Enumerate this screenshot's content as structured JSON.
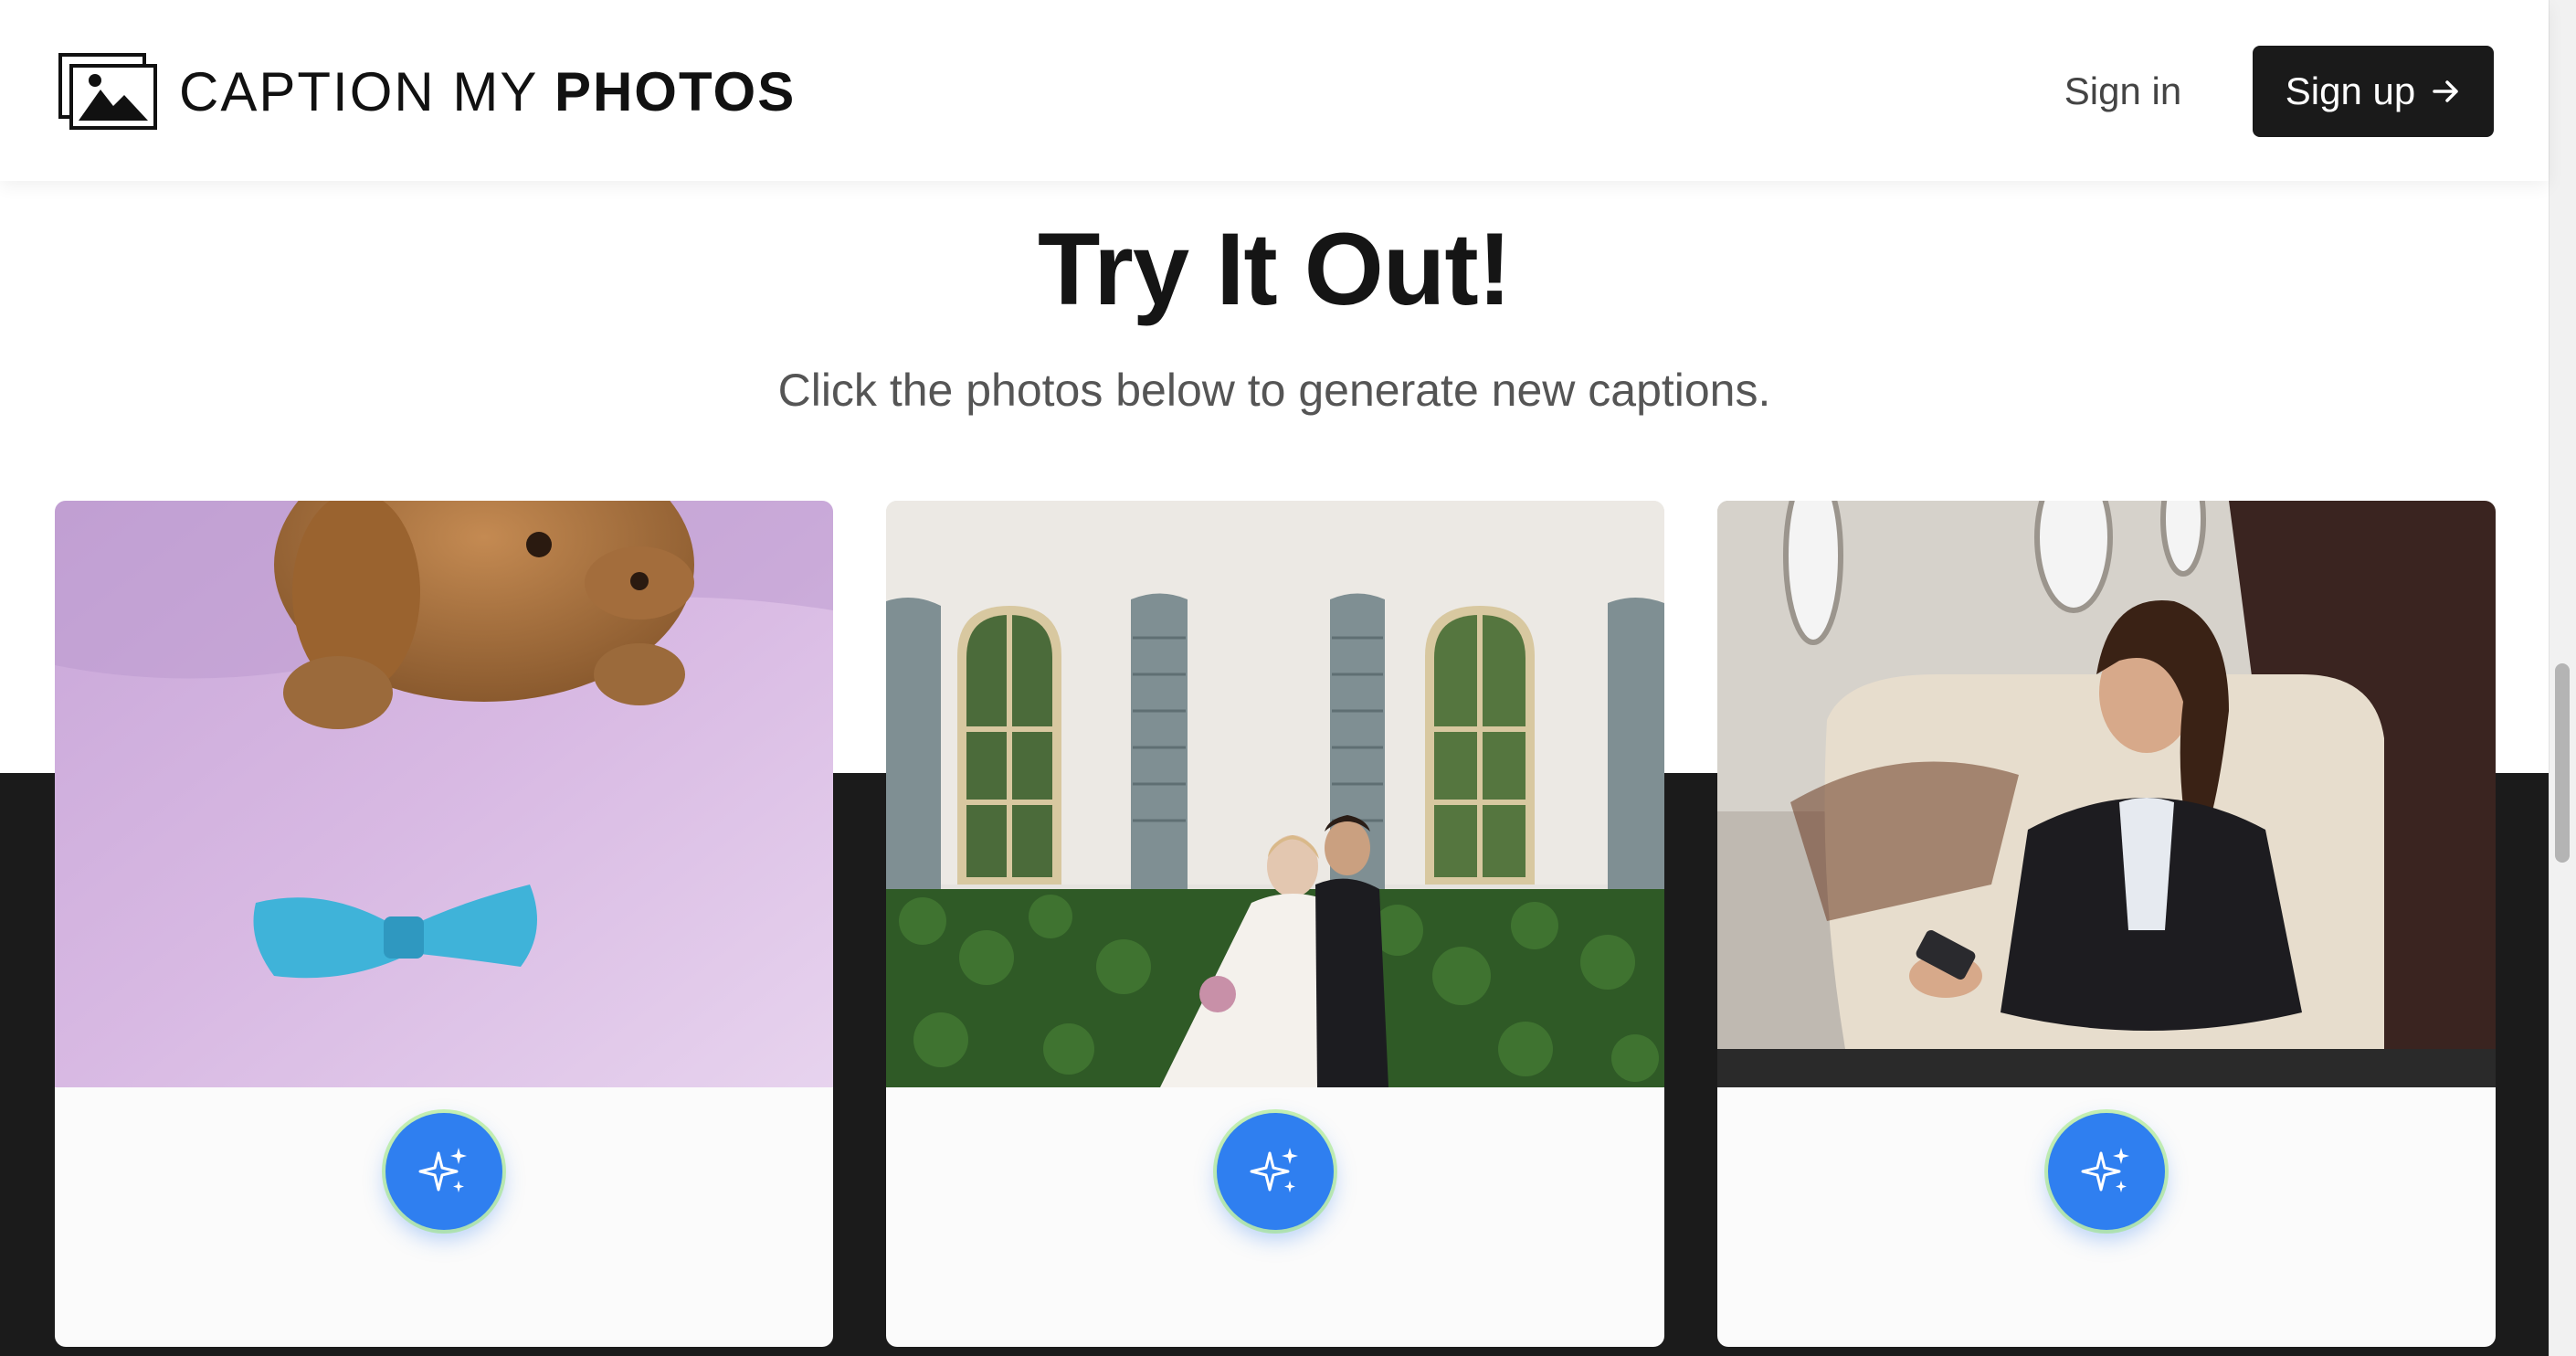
{
  "header": {
    "brand_light": "CAPTION MY ",
    "brand_bold": "PHOTOS",
    "signin_label": "Sign in",
    "signup_label": "Sign up"
  },
  "hero": {
    "title": "Try It Out!",
    "subtitle": "Click the photos below to generate new captions."
  },
  "cards": [
    {
      "photo": "puppy-with-blue-bow",
      "action_icon": "sparkles-icon"
    },
    {
      "photo": "wedding-couple-by-windows",
      "action_icon": "sparkles-icon"
    },
    {
      "photo": "woman-on-phone-in-jet",
      "action_icon": "sparkles-icon"
    }
  ],
  "colors": {
    "accent_button": "#2f7ff0",
    "dark_band": "#1b1b1b",
    "signup_bg": "#1a1a1a"
  }
}
